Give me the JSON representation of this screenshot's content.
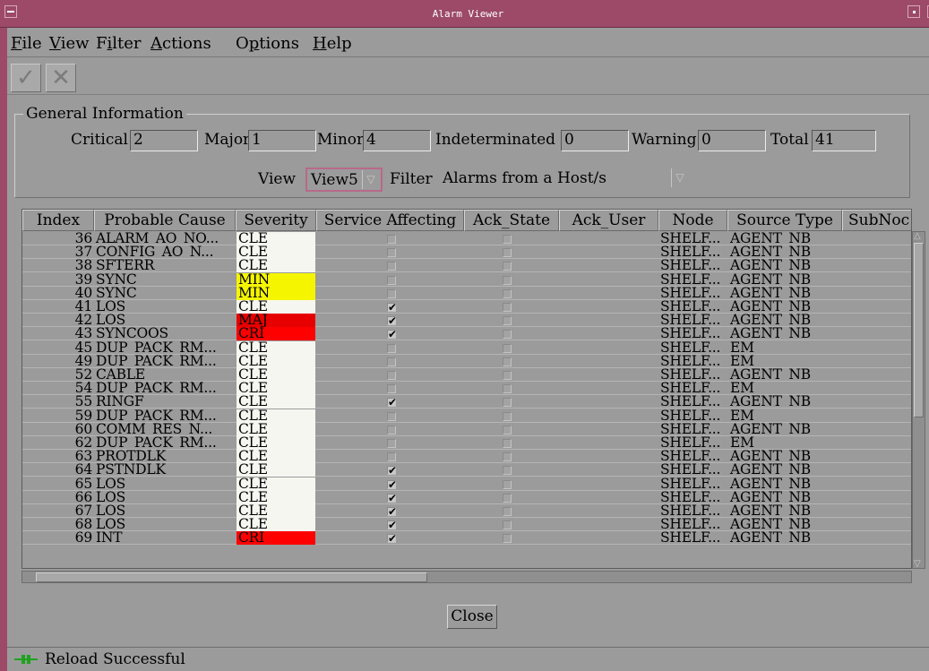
{
  "window": {
    "title": "Alarm Viewer"
  },
  "menu": [
    "File",
    "View",
    "Filter",
    "Actions",
    "Options",
    "Help"
  ],
  "menu_mnemonic": [
    "F",
    "V",
    "i",
    "A",
    "p",
    "H"
  ],
  "toolbar": {
    "ack_icon": "checkmark-icon",
    "unack_icon": "x-icon"
  },
  "general_info": {
    "legend": "General Information",
    "counts": [
      {
        "label": "Critical",
        "value": "2"
      },
      {
        "label": "Major",
        "value": "1"
      },
      {
        "label": "Minor",
        "value": "4"
      },
      {
        "label": "Indeterminated",
        "value": "0"
      },
      {
        "label": "Warning",
        "value": "0"
      },
      {
        "label": "Total",
        "value": "41"
      }
    ],
    "view_label": "View",
    "view_value": "View5",
    "filter_label": "Filter",
    "filter_value": "Alarms from a Host/s"
  },
  "table": {
    "columns": [
      "Index",
      "Probable Cause",
      "Severity",
      "Service Affecting",
      "Ack_State",
      "Ack_User",
      "Node",
      "Source Type",
      "SubNoc"
    ],
    "rows": [
      {
        "index": "36",
        "cause": "ALARM_AO_NO...",
        "severity": "CLE",
        "service": false,
        "node": "SHELF...",
        "source": "AGENT_NB"
      },
      {
        "index": "37",
        "cause": "CONFIG_AO_N...",
        "severity": "CLE",
        "service": false,
        "node": "SHELF...",
        "source": "AGENT_NB"
      },
      {
        "index": "38",
        "cause": "SFTERR",
        "severity": "CLE",
        "service": false,
        "node": "SHELF...",
        "source": "AGENT_NB"
      },
      {
        "index": "39",
        "cause": "SYNC",
        "severity": "MIN",
        "service": false,
        "node": "SHELF...",
        "source": "AGENT_NB"
      },
      {
        "index": "40",
        "cause": "SYNC",
        "severity": "MIN",
        "service": false,
        "node": "SHELF...",
        "source": "AGENT_NB"
      },
      {
        "index": "41",
        "cause": "LOS",
        "severity": "CLE",
        "service": true,
        "node": "SHELF...",
        "source": "AGENT_NB"
      },
      {
        "index": "42",
        "cause": "LOS",
        "severity": "MAJ",
        "service": true,
        "node": "SHELF...",
        "source": "AGENT_NB"
      },
      {
        "index": "43",
        "cause": "SYNCOOS",
        "severity": "CRI",
        "service": true,
        "node": "SHELF...",
        "source": "AGENT_NB"
      },
      {
        "index": "45",
        "cause": "DUP_PACK_RM...",
        "severity": "CLE",
        "service": false,
        "node": "SHELF...",
        "source": "EM"
      },
      {
        "index": "49",
        "cause": "DUP_PACK_RM...",
        "severity": "CLE",
        "service": false,
        "node": "SHELF...",
        "source": "EM"
      },
      {
        "index": "52",
        "cause": "CABLE",
        "severity": "CLE",
        "service": false,
        "node": "SHELF...",
        "source": "AGENT_NB"
      },
      {
        "index": "54",
        "cause": "DUP_PACK_RM...",
        "severity": "CLE",
        "service": false,
        "node": "SHELF...",
        "source": "EM"
      },
      {
        "index": "55",
        "cause": "RINGF",
        "severity": "CLE",
        "service": true,
        "node": "SHELF...",
        "source": "AGENT_NB"
      },
      {
        "index": "59",
        "cause": "DUP_PACK_RM...",
        "severity": "CLE",
        "service": false,
        "node": "SHELF...",
        "source": "EM"
      },
      {
        "index": "60",
        "cause": "COMM_RES_N...",
        "severity": "CLE",
        "service": false,
        "node": "SHELF...",
        "source": "AGENT_NB"
      },
      {
        "index": "62",
        "cause": "DUP_PACK_RM...",
        "severity": "CLE",
        "service": false,
        "node": "SHELF...",
        "source": "EM"
      },
      {
        "index": "63",
        "cause": "PROTDLK",
        "severity": "CLE",
        "service": false,
        "node": "SHELF...",
        "source": "AGENT_NB"
      },
      {
        "index": "64",
        "cause": "PSTNDLK",
        "severity": "CLE",
        "service": true,
        "node": "SHELF...",
        "source": "AGENT_NB"
      },
      {
        "index": "65",
        "cause": "LOS",
        "severity": "CLE",
        "service": true,
        "node": "SHELF...",
        "source": "AGENT_NB"
      },
      {
        "index": "66",
        "cause": "LOS",
        "severity": "CLE",
        "service": true,
        "node": "SHELF...",
        "source": "AGENT_NB"
      },
      {
        "index": "67",
        "cause": "LOS",
        "severity": "CLE",
        "service": true,
        "node": "SHELF...",
        "source": "AGENT_NB"
      },
      {
        "index": "68",
        "cause": "LOS",
        "severity": "CLE",
        "service": true,
        "node": "SHELF...",
        "source": "AGENT_NB"
      },
      {
        "index": "69",
        "cause": "INT",
        "severity": "CRI",
        "service": true,
        "node": "SHELF...",
        "source": "AGENT_NB"
      }
    ]
  },
  "severity_colors": {
    "CLE": "#f6f6f1",
    "MIN": "#f5f500",
    "MAJ": "#e60000",
    "CRI": "#ff0000"
  },
  "close_label": "Close",
  "status": {
    "icon": "plug-connected-icon",
    "text": "Reload Successful"
  }
}
